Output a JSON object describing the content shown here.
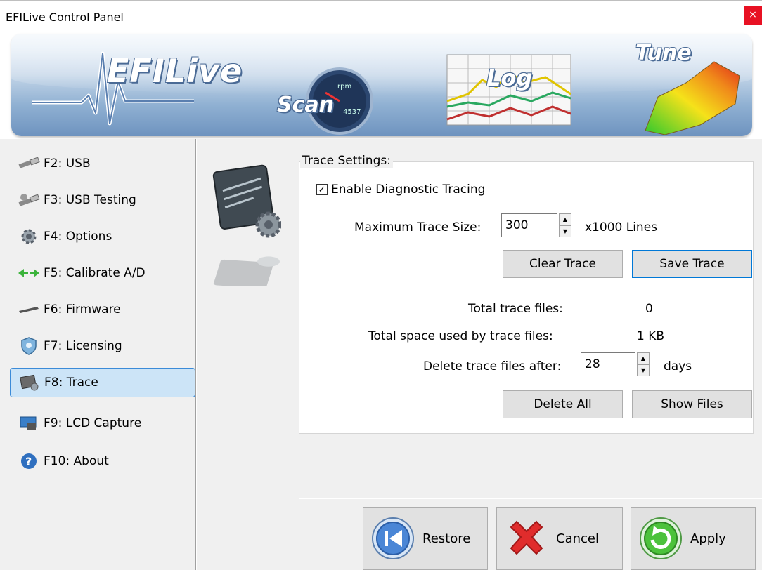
{
  "window": {
    "title": "EFILive Control Panel",
    "close_label": "×"
  },
  "banner": {
    "logo": "EFILive",
    "scan": "Scan",
    "log": "Log",
    "tune": "Tune",
    "gauge_rpm": "rpm",
    "gauge_value": "4537"
  },
  "sidebar": {
    "items": [
      {
        "label": "F2: USB",
        "icon": "usb-cable-icon"
      },
      {
        "label": "F3: USB Testing",
        "icon": "usb-testing-icon"
      },
      {
        "label": "F4: Options",
        "icon": "gear-options-icon"
      },
      {
        "label": "F5: Calibrate A/D",
        "icon": "calibrate-arrows-icon"
      },
      {
        "label": "F6: Firmware",
        "icon": "firmware-chip-icon"
      },
      {
        "label": "F7: Licensing",
        "icon": "license-shield-icon"
      },
      {
        "label": "F8: Trace",
        "icon": "trace-icon",
        "selected": true
      },
      {
        "label": "F9: LCD Capture",
        "icon": "lcd-capture-icon"
      },
      {
        "label": "F10: About",
        "icon": "help-about-icon"
      }
    ]
  },
  "trace": {
    "group_title": "Trace Settings:",
    "enable_label": "Enable Diagnostic Tracing",
    "enable_checked": true,
    "check_mark": "✓",
    "max_size_label": "Maximum Trace Size:",
    "max_size_value": "300",
    "max_size_unit": "x1000 Lines",
    "clear_label": "Clear Trace",
    "save_label": "Save Trace",
    "total_files_label": "Total trace files:",
    "total_files_value": "0",
    "total_space_label": "Total space used by trace files:",
    "total_space_value": "1 KB",
    "delete_after_label": "Delete trace files after:",
    "delete_after_value": "28",
    "delete_after_unit": "days",
    "delete_all_label": "Delete All",
    "show_files_label": "Show Files",
    "spin_up": "▲",
    "spin_down": "▼"
  },
  "footer": {
    "restore_label": "Restore",
    "cancel_label": "Cancel",
    "apply_label": "Apply"
  },
  "colors": {
    "accent": "#0078d7",
    "selection": "#cce4f7",
    "close": "#e81123"
  }
}
